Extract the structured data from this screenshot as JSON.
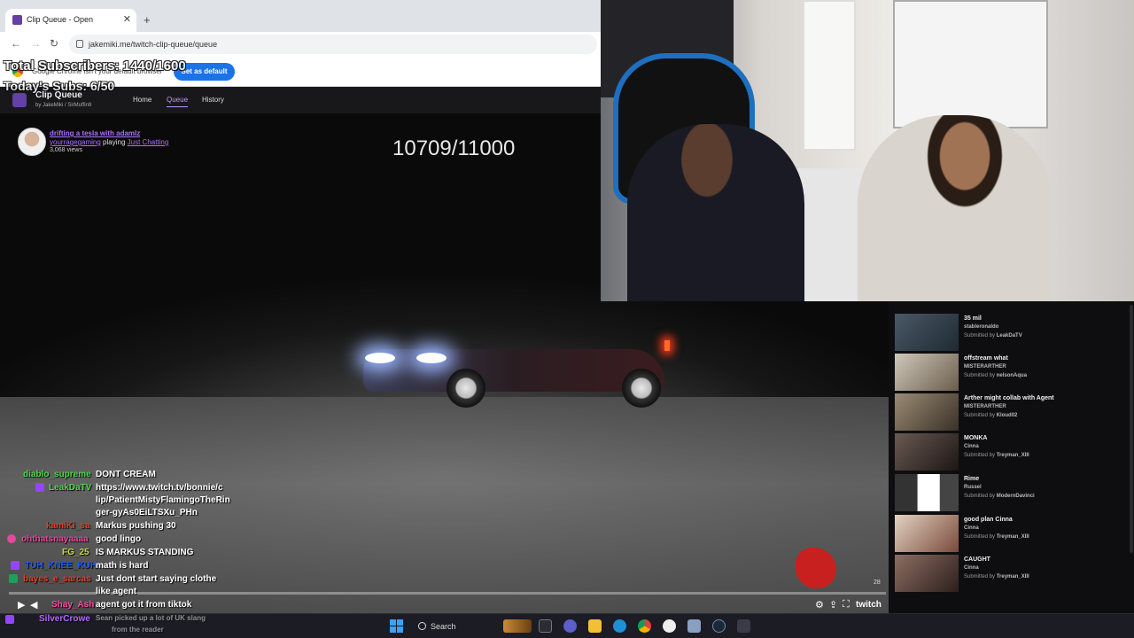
{
  "browser": {
    "tab_title": "Clip Queue - Open",
    "url": "jakemiki.me/twitch-clip-queue/queue",
    "infobar_message": "Google Chrome isn't your default browser",
    "set_default_label": "Set as default"
  },
  "overlay": {
    "total_subscribers": "Total Subscribers: 1440/1600",
    "todays_subs": "Today's Subs: 6/50"
  },
  "app": {
    "title": "Clip Queue",
    "byline": "by JakeMiki / SirMuffin9",
    "nav": [
      {
        "label": "Home"
      },
      {
        "label": "Queue"
      },
      {
        "label": "History"
      }
    ]
  },
  "clip": {
    "title": "drifting a tesla with adamlz",
    "channel": "yourragegaming",
    "playing_label": "playing",
    "game": "Just Chatting",
    "views": "3,068 views",
    "counter": "10709/11000",
    "viewer_count": "28"
  },
  "chat": [
    {
      "user": "diablo_supreme",
      "message": "DONT CREAM",
      "color": "#4fd64f"
    },
    {
      "user": "LeakDaTV",
      "message": "https://www.twitch.tv/bonnie/c",
      "color": "#4fd64f"
    },
    {
      "user": "",
      "message": "lip/PatientMistyFlamingoTheRin",
      "color": "#fff"
    },
    {
      "user": "",
      "message": "ger-gyAs0EiLTSXu_PHn",
      "color": "#fff"
    },
    {
      "user": "kamiKi_sa",
      "message": "Markus pushing 30",
      "color": "#d9452c"
    },
    {
      "user": "ohthatsnayaaaa",
      "message": "good lingo",
      "color": "#e4489b"
    },
    {
      "user": "FG_25",
      "message": "IS MARKUS STANDING",
      "color": "#c6d63f"
    },
    {
      "user": "TUH_KNEE_KUH",
      "message": "math is hard",
      "color": "#1e5bf5"
    },
    {
      "user": "bayes_e_sarcas",
      "message": "Just dont start saying clothe",
      "color": "#d9452c"
    },
    {
      "user": "",
      "message": "like agent",
      "color": "#fff"
    },
    {
      "user": "Shay_Ash",
      "message": "agent got it from tiktok",
      "color": "#ff4da6"
    },
    {
      "user": "SilverCrowe",
      "message": "Sean picked up a lot of UK slang",
      "color": "#b469ff"
    },
    {
      "user": "",
      "message": "from the reader",
      "color": "#fff"
    }
  ],
  "queue": [
    {
      "title": "35 mil",
      "channel": "stableronaldo",
      "submitted_by": "LeakDaTV"
    },
    {
      "title": "offstream what",
      "channel": "MISTERARTHER",
      "submitted_by": "nelsonAqua"
    },
    {
      "title": "Arther might collab with Agent",
      "channel": "MISTERARTHER",
      "submitted_by": "Kloud02"
    },
    {
      "title": "MONKA",
      "channel": "Cinna",
      "submitted_by": "Treyman_XIII"
    },
    {
      "title": "Rime",
      "channel": "Russel",
      "submitted_by": "ModernDavinci"
    },
    {
      "title": "good plan Cinna",
      "channel": "Cinna",
      "submitted_by": "Treyman_XIII"
    },
    {
      "title": "CAUGHT",
      "channel": "Cinna",
      "submitted_by": "Treyman_XIII"
    }
  ],
  "queue_labels": {
    "submitted_prefix": "Submitted by"
  },
  "player": {
    "twitch_label": "twitch"
  },
  "taskbar": {
    "search_label": "Search"
  }
}
